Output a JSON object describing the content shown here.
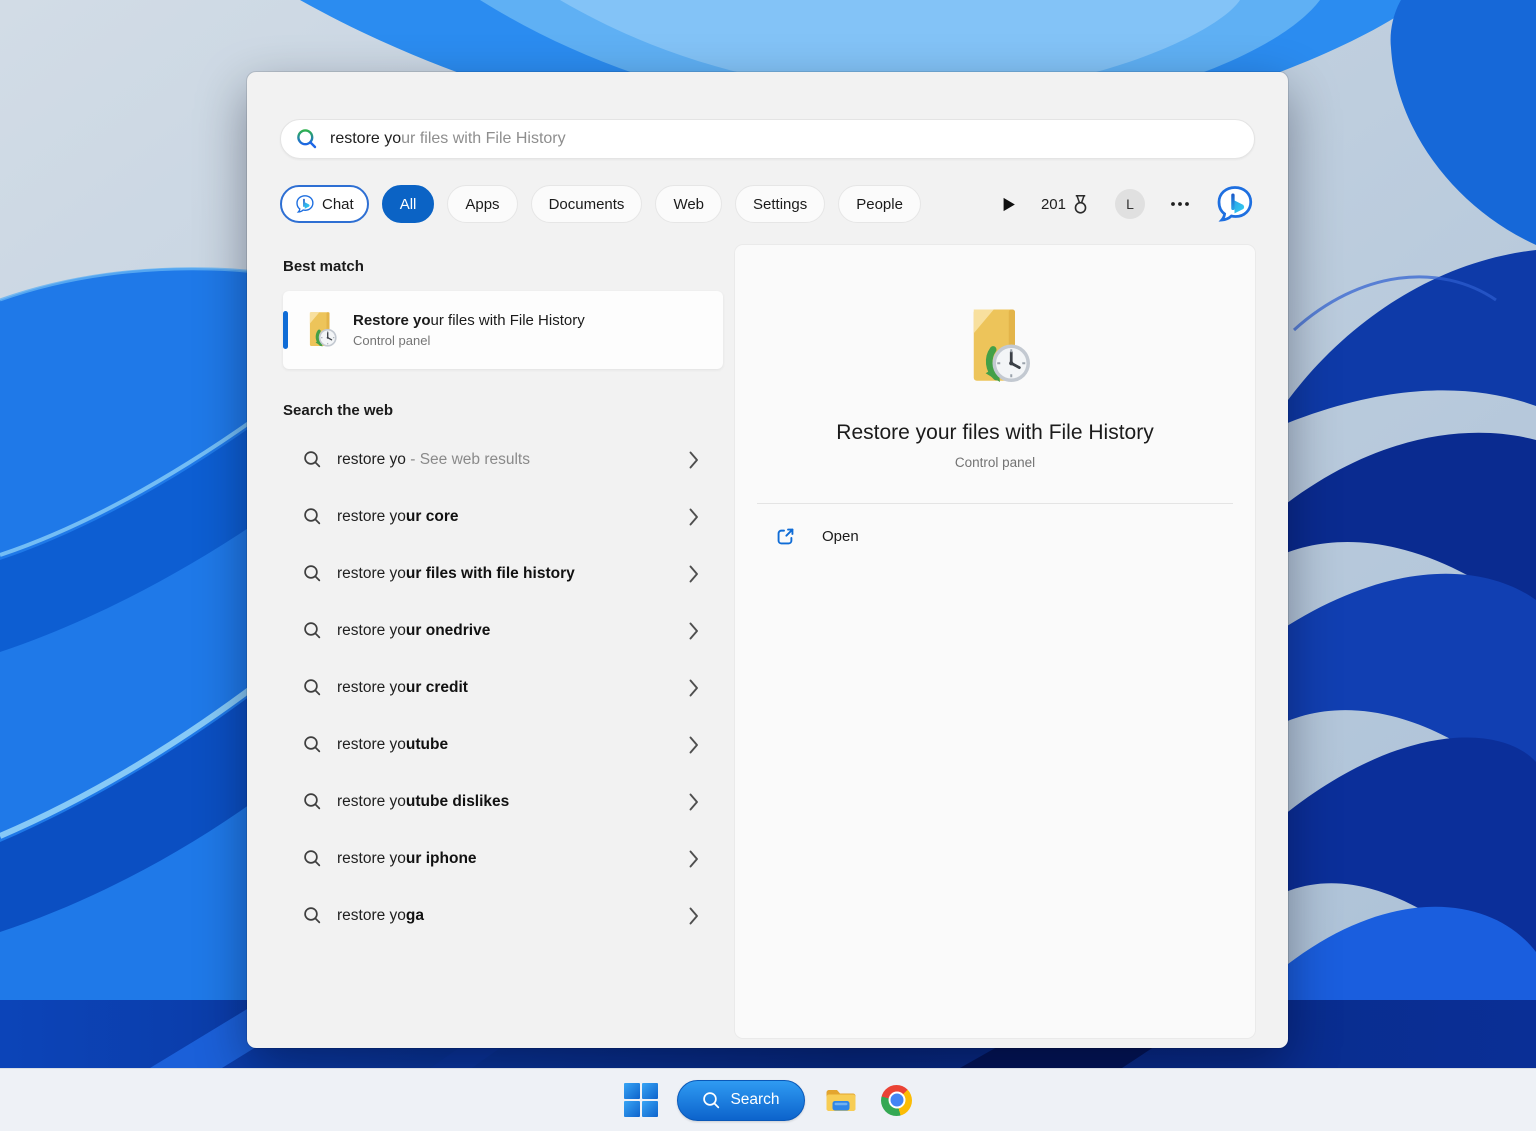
{
  "search_panel": {
    "search_box": {
      "typed_text": "restore yo",
      "suggestion_text": "ur files with File History"
    },
    "tabs": {
      "chat_label": "Chat",
      "filters": [
        "All",
        "Apps",
        "Documents",
        "Web",
        "Settings",
        "People"
      ],
      "active_filter": "All",
      "rewards_points": "201",
      "avatar_initial": "L"
    },
    "best_match": {
      "section_label": "Best match",
      "title_match": "Restore yo",
      "title_rest": "ur files with File History",
      "subtitle": "Control panel"
    },
    "web_section": {
      "section_label": "Search the web",
      "suggestions": [
        {
          "typed": "restore yo",
          "completion": "",
          "note": " - See web results"
        },
        {
          "typed": "restore yo",
          "completion": "ur core",
          "note": ""
        },
        {
          "typed": "restore yo",
          "completion": "ur files with file history",
          "note": ""
        },
        {
          "typed": "restore yo",
          "completion": "ur onedrive",
          "note": ""
        },
        {
          "typed": "restore yo",
          "completion": "ur credit",
          "note": ""
        },
        {
          "typed": "restore yo",
          "completion": "utube",
          "note": ""
        },
        {
          "typed": "restore yo",
          "completion": "utube dislikes",
          "note": ""
        },
        {
          "typed": "restore yo",
          "completion": "ur iphone",
          "note": ""
        },
        {
          "typed": "restore yo",
          "completion": "ga",
          "note": ""
        }
      ]
    },
    "preview": {
      "title": "Restore your files with File History",
      "subtitle": "Control panel",
      "open_label": "Open"
    }
  },
  "taskbar": {
    "search_label": "Search"
  },
  "colors": {
    "accent_blue": "#0b63c5",
    "best_match_accent": "#0f6cd6",
    "panel_bg": "#f2f2f2",
    "wallpaper_bright_blue": "#1f79e8",
    "wallpaper_navy": "#0a2b90"
  }
}
